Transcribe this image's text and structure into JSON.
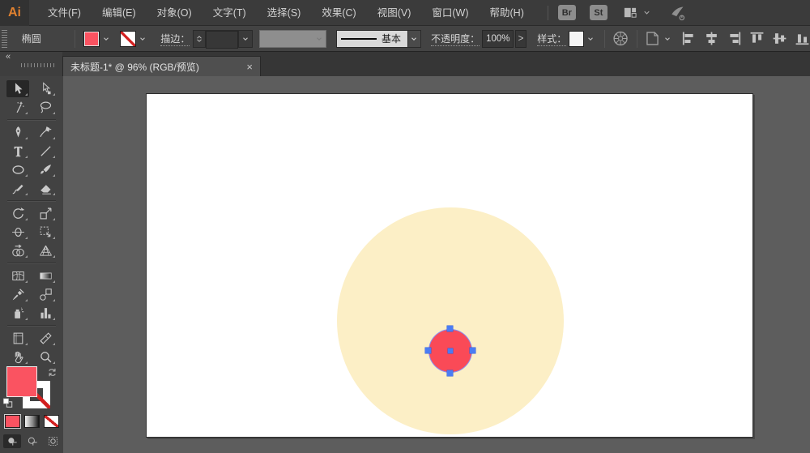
{
  "colors": {
    "accent_red": "#fa4a57",
    "fill_swatch": "#fa5361",
    "cream_circle": "#fcefc6",
    "selection_blue": "#4a7cf4",
    "selection_outline": "#8a8ff2",
    "logo_orange": "#e0812f"
  },
  "menubar": {
    "logo": "Ai",
    "items": [
      "文件(F)",
      "编辑(E)",
      "对象(O)",
      "文字(T)",
      "选择(S)",
      "效果(C)",
      "视图(V)",
      "窗口(W)",
      "帮助(H)"
    ],
    "bridge_button": "Br",
    "stock_button": "St"
  },
  "controlbar": {
    "tool_name": "椭圆",
    "stroke_label": "描边：",
    "stroke_value": "",
    "brush_preset": "基本",
    "opacity_label": "不透明度：",
    "opacity_value": "100%",
    "more_options": ">",
    "style_label": "样式：",
    "align_tools": [
      {
        "name": "align-left-button",
        "icon": "align-left"
      },
      {
        "name": "align-h-center-button",
        "icon": "align-h-center"
      },
      {
        "name": "align-right-button",
        "icon": "align-right"
      },
      {
        "name": "align-top-button",
        "icon": "align-top"
      },
      {
        "name": "align-v-center-button",
        "icon": "align-v-center"
      },
      {
        "name": "align-bottom-button",
        "icon": "align-bottom"
      }
    ]
  },
  "tabbar": {
    "collapse": "«",
    "document_title": "未标题-1* @ 96% (RGB/预览)",
    "close": "×"
  },
  "toolbar": {
    "groups": [
      [
        [
          {
            "name": "selection-tool",
            "icon": "selection",
            "active": true
          },
          {
            "name": "direct-selection-tool",
            "icon": "direct-selection"
          }
        ],
        [
          {
            "name": "magic-wand-tool",
            "icon": "magic-wand"
          },
          {
            "name": "lasso-tool",
            "icon": "lasso"
          }
        ]
      ],
      [
        [
          {
            "name": "pen-tool",
            "icon": "pen"
          },
          {
            "name": "curvature-tool",
            "icon": "curvature"
          }
        ],
        [
          {
            "name": "type-tool",
            "icon": "type"
          },
          {
            "name": "line-segment-tool",
            "icon": "line-segment"
          }
        ],
        [
          {
            "name": "ellipse-tool",
            "icon": "ellipse"
          },
          {
            "name": "paintbrush-tool",
            "icon": "paintbrush"
          }
        ],
        [
          {
            "name": "pencil-tool",
            "icon": "pencil"
          },
          {
            "name": "eraser-tool",
            "icon": "eraser"
          }
        ]
      ],
      [
        [
          {
            "name": "rotate-tool",
            "icon": "rotate"
          },
          {
            "name": "scale-tool",
            "icon": "scale"
          }
        ],
        [
          {
            "name": "width-tool",
            "icon": "width"
          },
          {
            "name": "free-transform-tool",
            "icon": "free-transform"
          }
        ],
        [
          {
            "name": "shape-builder-tool",
            "icon": "shape-builder"
          },
          {
            "name": "perspective-grid-tool",
            "icon": "perspective-grid"
          }
        ]
      ],
      [
        [
          {
            "name": "mesh-tool",
            "icon": "mesh"
          },
          {
            "name": "gradient-tool",
            "icon": "gradient"
          }
        ],
        [
          {
            "name": "eyedropper-tool",
            "icon": "eyedropper"
          },
          {
            "name": "blend-tool",
            "icon": "blend"
          }
        ],
        [
          {
            "name": "symbol-sprayer-tool",
            "icon": "symbol-sprayer"
          },
          {
            "name": "column-graph-tool",
            "icon": "column-graph"
          }
        ]
      ],
      [
        [
          {
            "name": "artboard-tool",
            "icon": "artboard"
          },
          {
            "name": "slice-tool",
            "icon": "slice"
          }
        ],
        [
          {
            "name": "hand-tool",
            "icon": "hand"
          },
          {
            "name": "zoom-tool",
            "icon": "zoom"
          }
        ]
      ]
    ]
  },
  "document": {
    "shapes": [
      {
        "type": "ellipse",
        "fill": "#fcefc6",
        "selected": false
      },
      {
        "type": "ellipse",
        "fill": "#fa4a57",
        "selected": true
      }
    ]
  }
}
